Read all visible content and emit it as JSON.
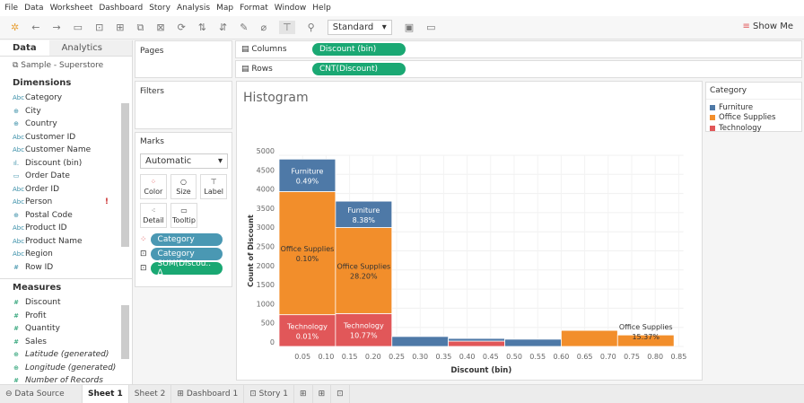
{
  "menu": [
    "File",
    "Data",
    "Worksheet",
    "Dashboard",
    "Story",
    "Analysis",
    "Map",
    "Format",
    "Window",
    "Help"
  ],
  "toolbar": {
    "fit": "Standard",
    "show_me": "Show Me"
  },
  "left": {
    "tab_data": "Data",
    "tab_analytics": "Analytics",
    "source": "Sample - Superstore",
    "dimensions_title": "Dimensions",
    "dimensions": [
      {
        "icon": "Abc",
        "label": "Category"
      },
      {
        "icon": "⊕",
        "label": "City"
      },
      {
        "icon": "⊕",
        "label": "Country"
      },
      {
        "icon": "Abc",
        "label": "Customer ID"
      },
      {
        "icon": "Abc",
        "label": "Customer Name"
      },
      {
        "icon": "ıl.",
        "label": "Discount (bin)"
      },
      {
        "icon": "▭",
        "label": "Order Date"
      },
      {
        "icon": "Abc",
        "label": "Order ID"
      },
      {
        "icon": "Abc",
        "label": "Person",
        "warn": "!"
      },
      {
        "icon": "⊕",
        "label": "Postal Code"
      },
      {
        "icon": "Abc",
        "label": "Product ID"
      },
      {
        "icon": "Abc",
        "label": "Product Name"
      },
      {
        "icon": "Abc",
        "label": "Region"
      },
      {
        "icon": "#",
        "label": "Row ID"
      }
    ],
    "measures_title": "Measures",
    "measures": [
      {
        "icon": "#",
        "label": "Discount"
      },
      {
        "icon": "#",
        "label": "Profit"
      },
      {
        "icon": "#",
        "label": "Quantity"
      },
      {
        "icon": "#",
        "label": "Sales"
      },
      {
        "icon": "⊕",
        "label": "Latitude (generated)",
        "italic": true
      },
      {
        "icon": "⊕",
        "label": "Longitude (generated)",
        "italic": true
      },
      {
        "icon": "#",
        "label": "Number of Records",
        "italic": true
      }
    ]
  },
  "pages": "Pages",
  "filters": "Filters",
  "marks": {
    "title": "Marks",
    "type": "Automatic",
    "buttons": [
      "Color",
      "Size",
      "Label",
      "Detail",
      "Tooltip"
    ],
    "pills": [
      "Category",
      "Category",
      "SUM(Discou.. ∆"
    ]
  },
  "shelves": {
    "columns_label": "Columns",
    "columns_pill": "Discount (bin)",
    "rows_label": "Rows",
    "rows_pill": "CNT(Discount)"
  },
  "legend": {
    "title": "Category",
    "items": [
      {
        "label": "Furniture",
        "color": "#4e79a7"
      },
      {
        "label": "Office Supplies",
        "color": "#f28e2b"
      },
      {
        "label": "Technology",
        "color": "#e15759"
      }
    ]
  },
  "chart_data": {
    "type": "bar",
    "title": "Histogram",
    "xlabel": "Discount (bin)",
    "ylabel": "Count of Discount",
    "ylim": [
      0,
      5000
    ],
    "yticks": [
      0,
      500,
      1000,
      1500,
      2000,
      2500,
      3000,
      3500,
      4000,
      4500,
      5000
    ],
    "xticks": [
      "0.05",
      "0.10",
      "0.15",
      "0.20",
      "0.25",
      "0.30",
      "0.35",
      "0.40",
      "0.45",
      "0.50",
      "0.55",
      "0.60",
      "0.65",
      "0.70",
      "0.75",
      "0.80",
      "0.85"
    ],
    "bin_size": 0.12,
    "bins": [
      {
        "start": 0.0,
        "segments": [
          {
            "category": "Technology",
            "value": 830,
            "label": "Technology",
            "pct": "0.01%"
          },
          {
            "category": "Office Supplies",
            "value": 3220,
            "label": "Office Supplies",
            "pct": "0.10%"
          },
          {
            "category": "Furniture",
            "value": 850,
            "label": "Furniture",
            "pct": "0.49%"
          }
        ]
      },
      {
        "start": 0.12,
        "segments": [
          {
            "category": "Technology",
            "value": 860,
            "label": "Technology",
            "pct": "10.77%"
          },
          {
            "category": "Office Supplies",
            "value": 2250,
            "label": "Office Supplies",
            "pct": "28.20%"
          },
          {
            "category": "Furniture",
            "value": 690,
            "label": "Furniture",
            "pct": "8.38%"
          }
        ]
      },
      {
        "start": 0.24,
        "segments": [
          {
            "category": "Furniture",
            "value": 260
          }
        ]
      },
      {
        "start": 0.36,
        "segments": [
          {
            "category": "Technology",
            "value": 140
          },
          {
            "category": "Furniture",
            "value": 70
          }
        ]
      },
      {
        "start": 0.48,
        "segments": [
          {
            "category": "Furniture",
            "value": 190
          }
        ]
      },
      {
        "start": 0.6,
        "segments": [
          {
            "category": "Office Supplies",
            "value": 420
          }
        ]
      },
      {
        "start": 0.72,
        "segments": [
          {
            "category": "Office Supplies",
            "value": 300,
            "label": "Office Supplies",
            "pct": "15.37%"
          }
        ]
      }
    ]
  },
  "bottom_tabs": [
    "Data Source",
    "Sheet 1",
    "Sheet 2",
    "Dashboard 1",
    "Story 1"
  ]
}
